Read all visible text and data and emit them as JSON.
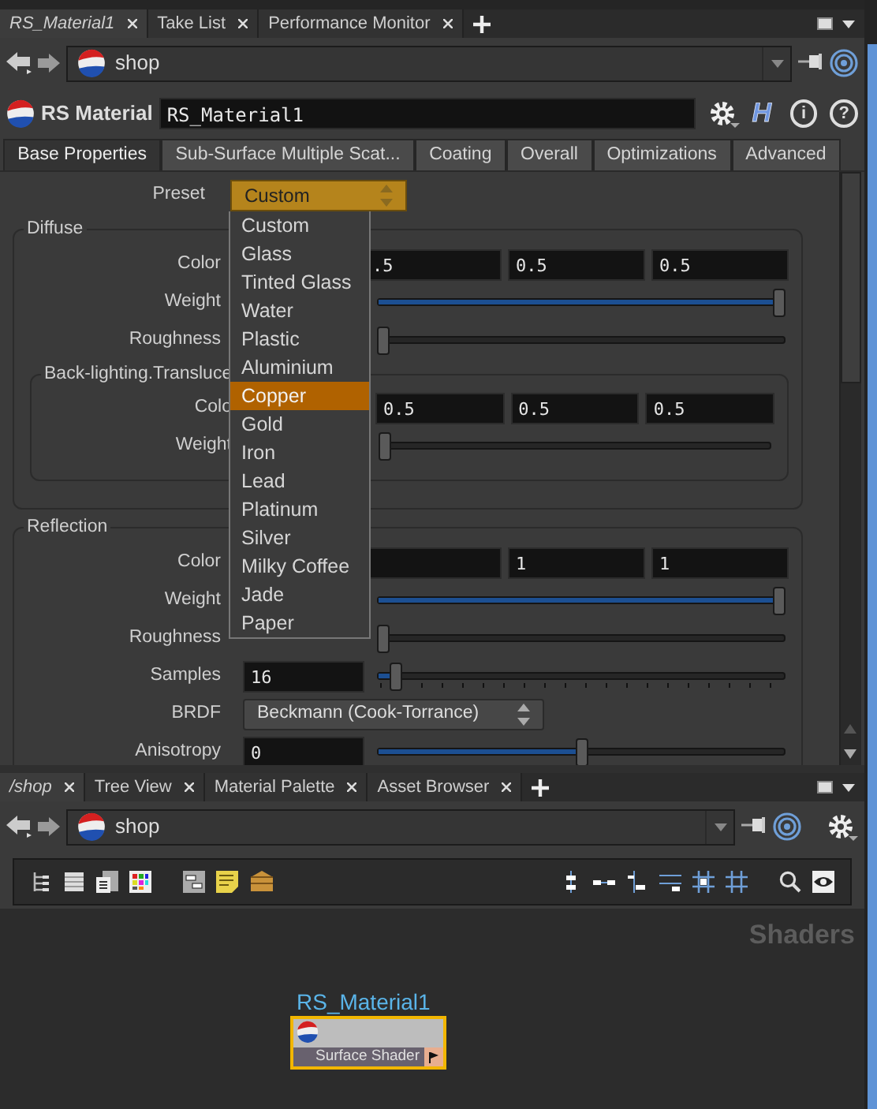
{
  "top_pane": {
    "tabs": [
      {
        "label": "RS_Material1",
        "selected": true
      },
      {
        "label": "Take List",
        "selected": false
      },
      {
        "label": "Performance Monitor",
        "selected": false
      }
    ],
    "path": "shop"
  },
  "parameter_editor": {
    "node_type": "RS Material",
    "node_name": "RS_Material1",
    "buttons": [
      {
        "kind": "gear"
      },
      {
        "kind": "hda",
        "label": "H"
      },
      {
        "kind": "info",
        "label": "i"
      },
      {
        "kind": "help",
        "label": "?"
      }
    ],
    "tabs": [
      {
        "label": "Base Properties",
        "selected": true
      },
      {
        "label": "Sub-Surface Multiple Scat...",
        "selected": false
      },
      {
        "label": "Coating",
        "selected": false
      },
      {
        "label": "Overall",
        "selected": false
      },
      {
        "label": "Optimizations",
        "selected": false
      },
      {
        "label": "Advanced",
        "selected": false
      }
    ],
    "preset": {
      "label": "Preset",
      "value": "Custom"
    },
    "groups": [
      {
        "title": "Diffuse",
        "rows": [
          {
            "kind": "vector",
            "label": "Color",
            "values": [
              ".5",
              "0.5",
              "0.5"
            ]
          },
          {
            "kind": "slider",
            "label": "Weight",
            "level": 1
          },
          {
            "kind": "slider",
            "label": "Roughness",
            "level": 0
          },
          {
            "kind": "group",
            "title": "Back-lighting.Transluce",
            "rows": [
              {
                "kind": "vector",
                "label": "Colo",
                "values": [
                  "0.5",
                  "0.5",
                  "0.5"
                ]
              },
              {
                "kind": "slider",
                "label": "Weight",
                "level": 0
              }
            ]
          }
        ]
      },
      {
        "title": "Reflection",
        "rows": [
          {
            "kind": "vector",
            "label": "Color",
            "values": [
              "1",
              "1"
            ]
          },
          {
            "kind": "slider",
            "label": "Weight",
            "level": 1
          },
          {
            "kind": "slider",
            "label": "Roughness",
            "level": 0
          },
          {
            "kind": "field_slider",
            "label": "Samples",
            "value": "16",
            "level": 0.03,
            "ticks": true
          },
          {
            "kind": "menu",
            "label": "BRDF",
            "value": "Beckmann (Cook-Torrance)"
          },
          {
            "kind": "field_slider",
            "label": "Anisotropy",
            "value": "0",
            "level": 0.5
          }
        ]
      }
    ],
    "preset_menu": [
      {
        "label": "Custom",
        "selected": false
      },
      {
        "label": "Glass",
        "selected": false
      },
      {
        "label": "Tinted Glass",
        "selected": false
      },
      {
        "label": "Water",
        "selected": false
      },
      {
        "label": "Plastic",
        "selected": false
      },
      {
        "label": "Aluminium",
        "selected": false
      },
      {
        "label": "Copper",
        "selected": true
      },
      {
        "label": "Gold",
        "selected": false
      },
      {
        "label": "Iron",
        "selected": false
      },
      {
        "label": "Lead",
        "selected": false
      },
      {
        "label": "Platinum",
        "selected": false
      },
      {
        "label": "Silver",
        "selected": false
      },
      {
        "label": "Milky Coffee",
        "selected": false
      },
      {
        "label": "Jade",
        "selected": false
      },
      {
        "label": "Paper",
        "selected": false
      }
    ]
  },
  "bottom_pane": {
    "tabs": [
      {
        "label": "/shop",
        "selected": true
      },
      {
        "label": "Tree View",
        "selected": false
      },
      {
        "label": "Material Palette",
        "selected": false
      },
      {
        "label": "Asset Browser",
        "selected": false
      }
    ],
    "path": "shop",
    "network_label": "Shaders",
    "node": {
      "name": "RS_Material1",
      "type_label": "Surface Shader",
      "selected": true
    }
  }
}
